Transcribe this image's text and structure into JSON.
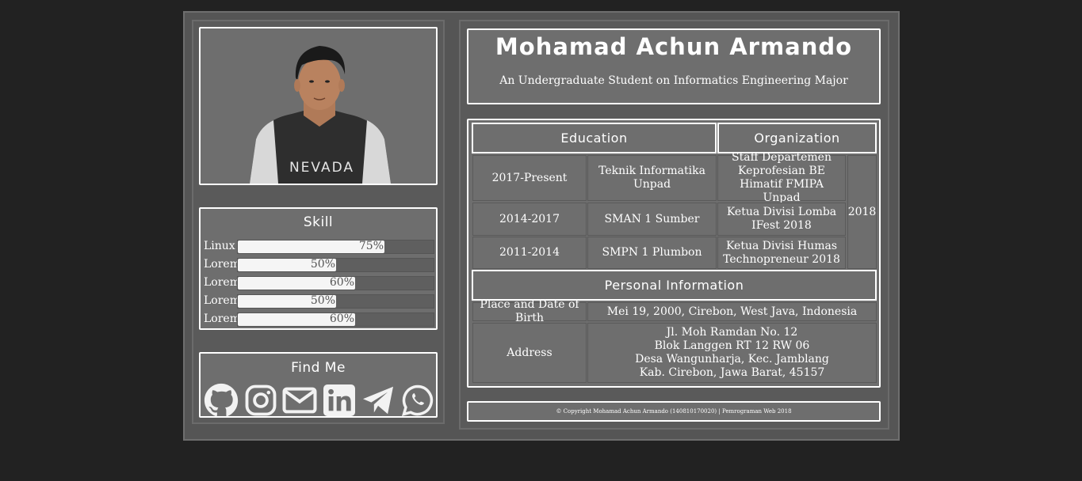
{
  "profile": {
    "name": "Mohamad Achun Armando",
    "subtitle": "An Undergraduate Student on Informatics Engineering Major",
    "photo_alt": "profile-photo",
    "shirt_text": "NEVADA"
  },
  "skill": {
    "title": "Skill",
    "items": [
      {
        "label": "Linux",
        "percent_text": "75%",
        "percent": 75
      },
      {
        "label": "Lorem",
        "percent_text": "50%",
        "percent": 50
      },
      {
        "label": "Lorem",
        "percent_text": "60%",
        "percent": 60
      },
      {
        "label": "Lorem",
        "percent_text": "50%",
        "percent": 50
      },
      {
        "label": "Lorem",
        "percent_text": "60%",
        "percent": 60
      }
    ]
  },
  "find_me": {
    "title": "Find Me",
    "icons": [
      "github-icon",
      "instagram-icon",
      "mail-icon",
      "linkedin-icon",
      "telegram-icon",
      "whatsapp-icon"
    ]
  },
  "table": {
    "education_header": "Education",
    "organization_header": "Organization",
    "education": [
      {
        "period": "2017-Present",
        "school": "Teknik Informatika Unpad"
      },
      {
        "period": "2014-2017",
        "school": "SMAN 1 Sumber"
      },
      {
        "period": "2011-2014",
        "school": "SMPN 1 Plumbon"
      }
    ],
    "organization": [
      {
        "role": "Staff Departemen Keprofesian BE Himatif FMIPA Unpad"
      },
      {
        "role": "Ketua Divisi Lomba IFest 2018"
      },
      {
        "role": "Ketua Divisi Humas Technopreneur 2018"
      }
    ],
    "organization_year": "2018",
    "personal_header": "Personal Information",
    "birth_label": "Place and Date of Birth",
    "birth_value": "Mei 19, 2000, Cirebon, West Java, Indonesia",
    "address_label": "Address",
    "address_lines": [
      "Jl. Moh Ramdan No. 12",
      "Blok Langgen RT 12 RW 06",
      "Desa Wangunharja, Kec. Jamblang",
      "Kab. Cirebon, Jawa Barat, 45157"
    ]
  },
  "footer": {
    "copyright": "© Copyright Mohamad Achun Armando (140810170020) | Pemrograman Web 2018"
  },
  "colors": {
    "background": "#222222",
    "panel": "#6e6e6e",
    "border": "#ffffff"
  }
}
